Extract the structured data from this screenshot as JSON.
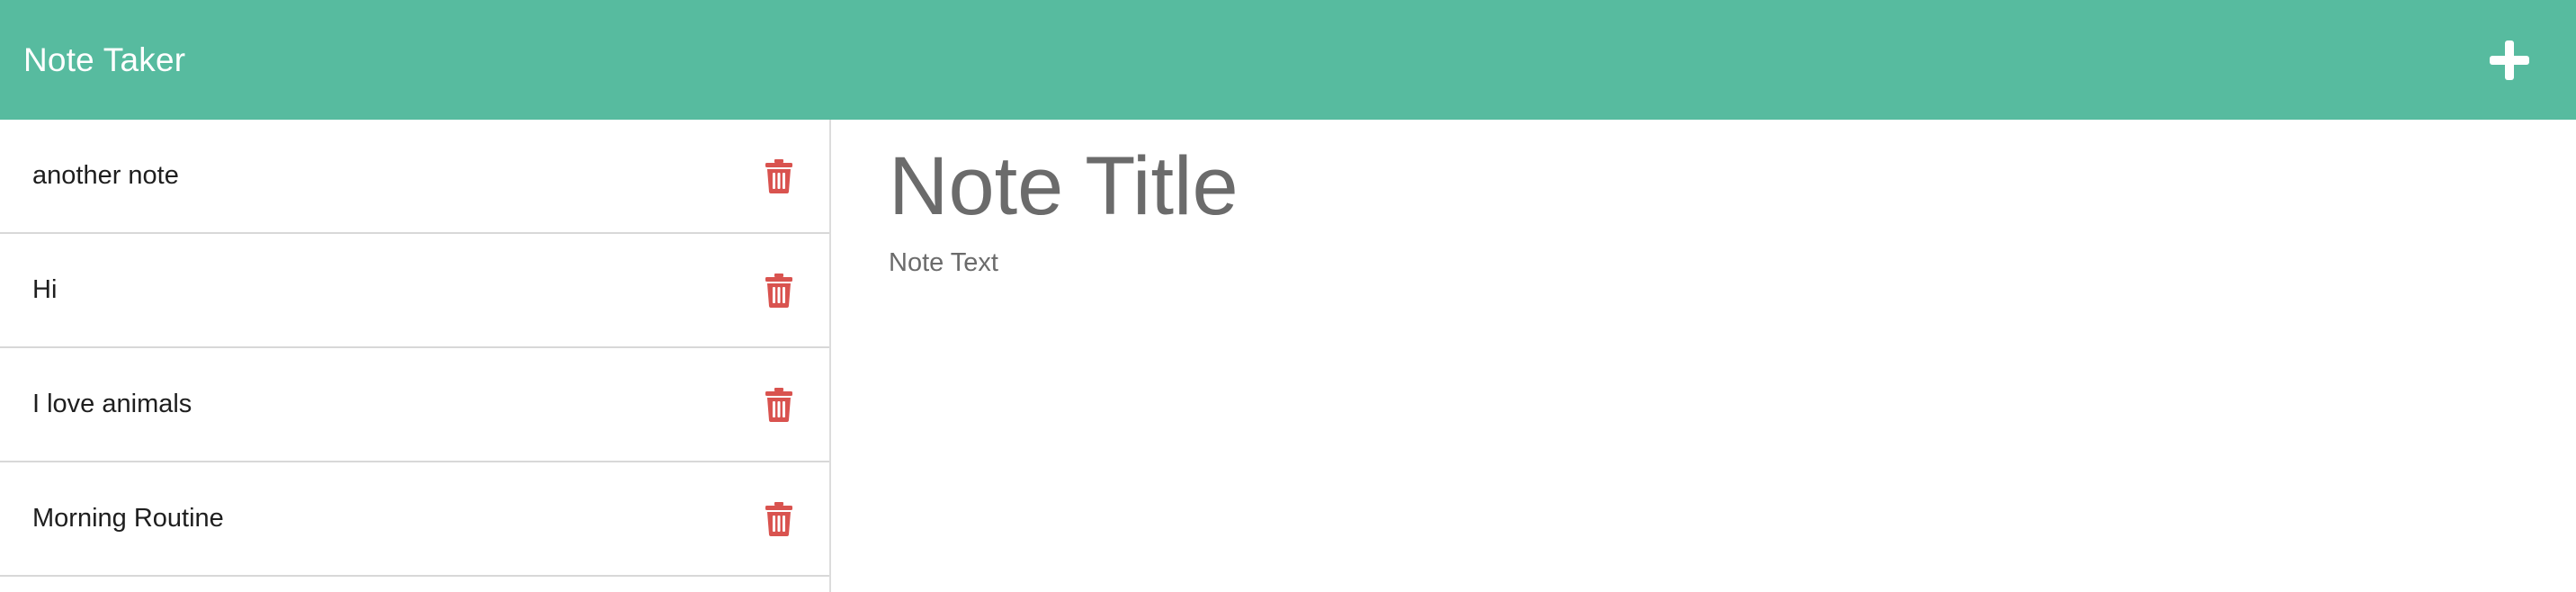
{
  "navbar": {
    "brand": "Note Taker",
    "new_note_icon": "plus-icon",
    "color": "#57bb9f"
  },
  "notes": [
    {
      "title": "another note",
      "delete_icon": "trash-icon"
    },
    {
      "title": "Hi",
      "delete_icon": "trash-icon"
    },
    {
      "title": "I love animals",
      "delete_icon": "trash-icon"
    },
    {
      "title": "Morning Routine",
      "delete_icon": "trash-icon"
    }
  ],
  "editor": {
    "title_placeholder": "Note Title",
    "text_placeholder": "Note Text"
  },
  "colors": {
    "accent": "#57bb9f",
    "delete": "#d9534f",
    "placeholder_text": "#6b6b6b"
  }
}
